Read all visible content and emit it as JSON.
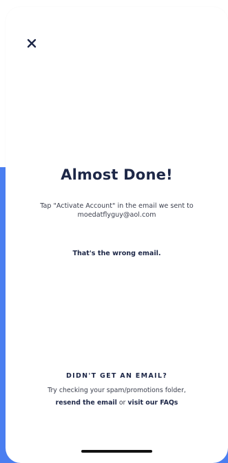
{
  "header": {
    "close_icon": "close-icon"
  },
  "main": {
    "title": "Almost Done!",
    "instruction_line1": "Tap \"Activate Account\" in the email we sent to",
    "email": "moedatflyguy@aol.com",
    "wrong_email_link": "That's the wrong email."
  },
  "footer": {
    "heading": "DIDN'T GET AN EMAIL?",
    "hint": "Try checking your spam/promotions folder,",
    "resend_link": "resend the email",
    "or_text": "or",
    "faq_link": "visit our FAQs"
  },
  "colors": {
    "accent_blue": "#4a7ef0",
    "text_dark": "#1d2747"
  }
}
